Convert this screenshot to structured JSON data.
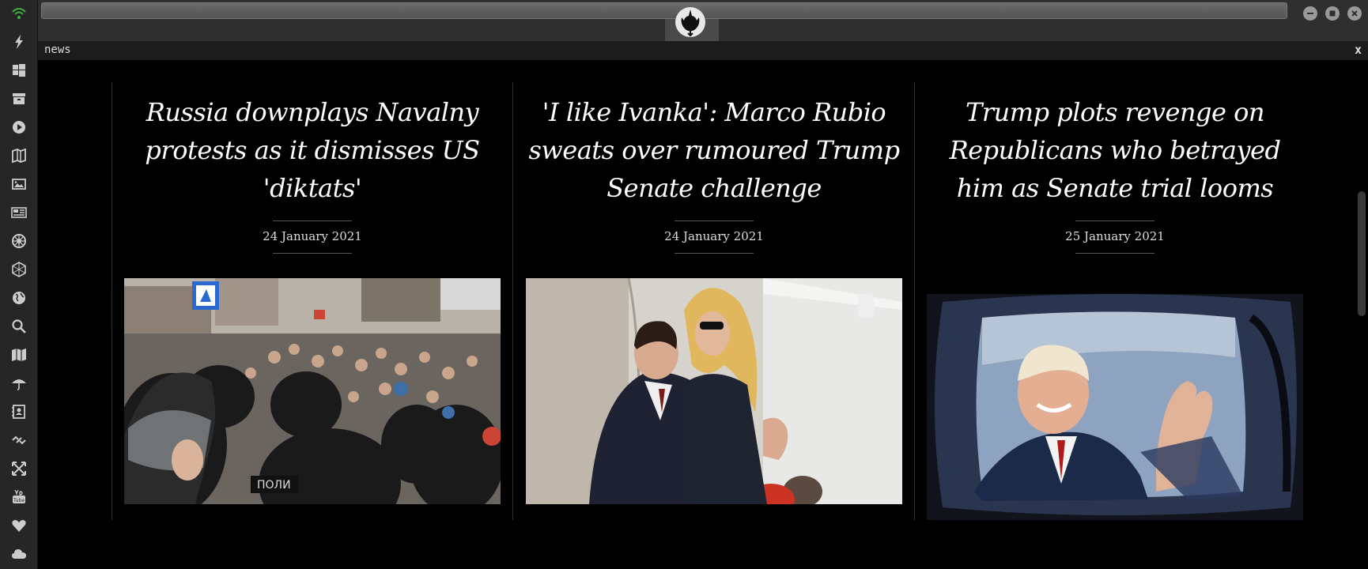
{
  "window": {
    "title": "news",
    "close_label": "x"
  },
  "dock": {
    "items": [
      "wifi-icon",
      "bolt-icon",
      "windows-icon",
      "archive-icon",
      "play-icon",
      "map-book-icon",
      "image-icon",
      "newspaper-icon",
      "empire-icon",
      "hexagon-icon",
      "globe-icon",
      "search-icon",
      "map-icon",
      "umbrella-icon",
      "contacts-icon",
      "link-icon",
      "expand-icon",
      "youtube-icon",
      "heart-icon",
      "cloud-icon"
    ],
    "accent_color": "#3cb043"
  },
  "articles": [
    {
      "headline": "Russia downplays Navalny protests as it dismisses US 'diktats'",
      "date": "24 January 2021",
      "image": "riot police and protesters crowd"
    },
    {
      "headline": "'I like Ivanka': Marco Rubio sweats over rumoured Trump Senate challenge",
      "date": "24 January 2021",
      "image": "man and blonde woman embracing"
    },
    {
      "headline": "Trump plots revenge on Republicans who betrayed him as Senate trial looms",
      "date": "25 January 2021",
      "image": "man waving from car window"
    }
  ]
}
